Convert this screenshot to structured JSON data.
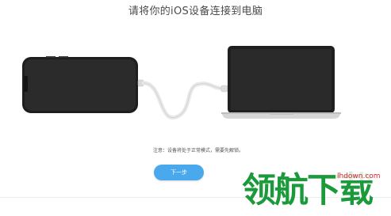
{
  "header": {
    "title": "请将你的iOS设备连接到电脑"
  },
  "notice": {
    "text": "注意：设备将处于正常模式，需要先解锁。"
  },
  "actions": {
    "next_label": "下一步"
  },
  "watermark": {
    "brand": "领航下载",
    "site": "lhdown.com"
  },
  "colors": {
    "accent": "#4aa8ec",
    "watermark_green": "#1b9a3b",
    "watermark_red": "#d8242a"
  },
  "icons": [
    "iphone-icon",
    "usb-cable-icon",
    "laptop-icon"
  ]
}
